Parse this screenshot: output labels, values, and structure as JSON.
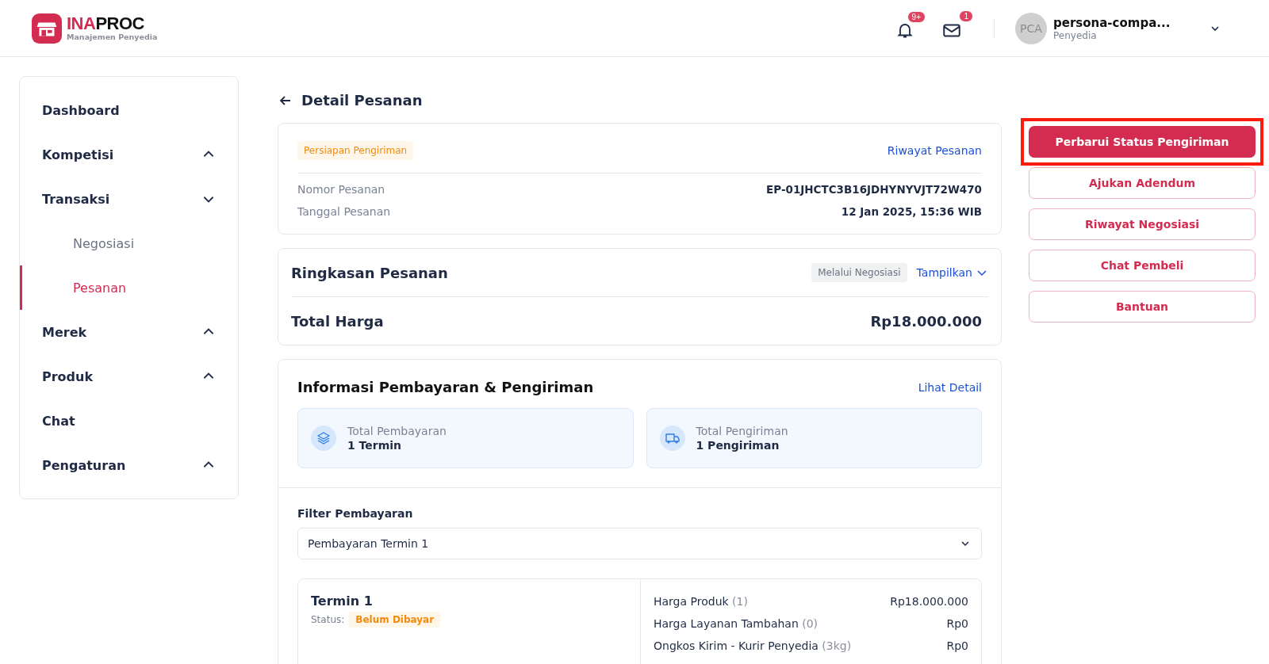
{
  "header": {
    "brand": {
      "part_1": "INA",
      "part_2": "PROC",
      "subtitle": "Manajemen Penyedia"
    },
    "notification_badge": "9+",
    "mail_badge": "1",
    "user": {
      "initials": "PCA",
      "name": "persona-compa...",
      "role": "Penyedia"
    }
  },
  "sidebar": {
    "items": [
      {
        "label": "Dashboard",
        "selected": false
      },
      {
        "label": "Kompetisi",
        "selected": false,
        "expanded": false
      },
      {
        "label": "Transaksi",
        "selected": false,
        "expanded": true,
        "children": [
          {
            "label": "Negosiasi",
            "selected": false
          },
          {
            "label": "Pesanan",
            "selected": true
          }
        ]
      },
      {
        "label": "Merek",
        "selected": false,
        "expanded": false
      },
      {
        "label": "Produk",
        "selected": false,
        "expanded": false
      },
      {
        "label": "Chat",
        "selected": false
      },
      {
        "label": "Pengaturan",
        "selected": false,
        "expanded": false
      }
    ]
  },
  "page_title": "Detail Pesanan",
  "order_card": {
    "status_badge": "Persiapan Pengiriman",
    "history_link": "Riwayat Pesanan",
    "fields": [
      {
        "label": "Nomor Pesanan",
        "value": "EP-01JHCTC3B16JDHYNYVJT72W470"
      },
      {
        "label": "Tanggal Pesanan",
        "value": "12 Jan 2025, 15:36 WIB"
      }
    ]
  },
  "summary_card": {
    "title": "Ringkasan Pesanan",
    "tag": "Melalui Negosiasi",
    "toggle": "Tampilkan",
    "total_label": "Total Harga",
    "total_value": "Rp18.000.000"
  },
  "payment_card": {
    "title": "Informasi Pembayaran & Pengiriman",
    "link": "Lihat Detail",
    "stats": [
      {
        "kind": "payment",
        "label": "Total Pembayaran",
        "value": "1 Termin"
      },
      {
        "kind": "shipping",
        "label": "Total Pengiriman",
        "value": "1 Pengiriman"
      }
    ],
    "filter_label": "Filter Pembayaran",
    "filter_value": "Pembayaran Termin 1",
    "term": {
      "title": "Termin 1",
      "status_label": "Status:",
      "status": "Belum Dibayar",
      "lines": [
        {
          "label": "Harga Produk",
          "count": "(1)",
          "value": "Rp18.000.000"
        },
        {
          "label": "Harga Layanan Tambahan",
          "count": "(0)",
          "value": "Rp0"
        },
        {
          "label": "Ongkos Kirim - Kurir Penyedia",
          "count": "(3kg)",
          "value": "Rp0"
        }
      ]
    }
  },
  "actions": [
    {
      "label": "Perbarui Status Pengiriman",
      "kind": "primary",
      "highlighted": true
    },
    {
      "label": "Ajukan Adendum",
      "kind": "outline",
      "highlighted": false
    },
    {
      "label": "Riwayat Negosiasi",
      "kind": "outline",
      "highlighted": false
    },
    {
      "label": "Chat Pembeli",
      "kind": "outline",
      "highlighted": false
    },
    {
      "label": "Bantuan",
      "kind": "outline",
      "highlighted": false
    }
  ]
}
